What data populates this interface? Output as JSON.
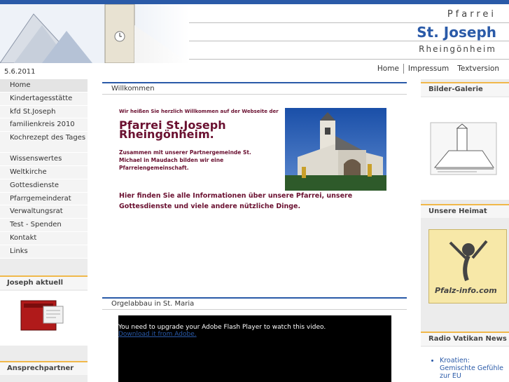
{
  "header": {
    "title_top": "Pfarrei",
    "title_main": "St. Joseph",
    "title_sub": "Rheingönheim"
  },
  "date": "5.6.2011",
  "topnav": [
    "Home",
    "Impressum",
    "Textversion"
  ],
  "nav": [
    {
      "label": "Home"
    },
    {
      "label": "Kindertagesstätte"
    },
    {
      "label": "kfd St.Joseph"
    },
    {
      "label": "familienkreis 2010"
    },
    {
      "label": "Kochrezept des Tages"
    },
    {
      "label": "Wissenswertes"
    },
    {
      "label": "Weltkirche"
    },
    {
      "label": "Gottesdienste"
    },
    {
      "label": "Pfarrgemeinderat"
    },
    {
      "label": "Verwaltungsrat"
    },
    {
      "label": "Test - Spenden"
    },
    {
      "label": "Kontakt"
    },
    {
      "label": "Links"
    }
  ],
  "left_boxes": {
    "joseph_aktuell": "Joseph aktuell",
    "ansprechpartner": "Ansprechpartner"
  },
  "main": {
    "welcome_head": "Willkommen",
    "welcome_small": "Wir heißen Sie herzlich Willkommen auf der Webseite der",
    "welcome_title": "Pfarrei St.Joseph Rheingönheim.",
    "welcome_sub": "Zusammen mit unserer Partnergemeinde St. Michael in Maudach bilden wir eine Pfarreiengemeinschaft.",
    "welcome_text": "Hier finden Sie alle Informationen über unsere Pfarrei, unsere Gottesdienste und viele andere nützliche Dinge.",
    "organ_head": "Orgelabbau in St. Maria",
    "video_msg": "You need to upgrade your Adobe Flash Player to watch this video.",
    "video_link": "Download it from Adobe."
  },
  "right": {
    "gallery_head": "Bilder-Galerie",
    "heimat_head": "Unsere Heimat",
    "pfalz_logo_text": "Pfalz-info.com",
    "radio_head": "Radio Vatikan News",
    "news": [
      "Kroatien: Gemischte Gefühle zur EU"
    ]
  },
  "colors": {
    "accent_blue": "#2a5aa8",
    "accent_orange": "#f0b84a",
    "welcome_text": "#6a1030"
  }
}
